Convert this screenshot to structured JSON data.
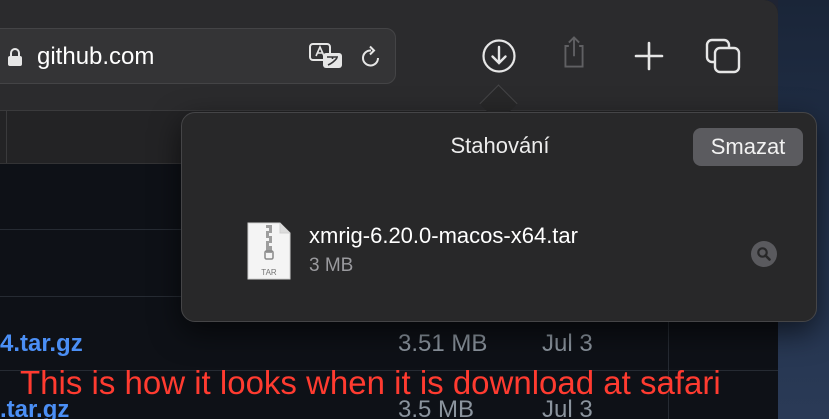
{
  "toolbar": {
    "url": "github.com"
  },
  "file_list": [
    {
      "name": "4.tar.gz",
      "size": "3.51 MB",
      "date": "Jul 3"
    },
    {
      "name": ".tar.gz",
      "size": "3.5 MB",
      "date": "Jul 3"
    }
  ],
  "downloads_popover": {
    "title": "Stahování",
    "clear_label": "Smazat",
    "items": [
      {
        "file_name": "xmrig-6.20.0-macos-x64.tar",
        "size": "3 MB",
        "file_type": "TAR"
      }
    ]
  },
  "annotation": "This is how it looks when it is download at safari",
  "colors": {
    "annotation": "#ff3b30",
    "link": "#4b8ff5",
    "popover_bg": "#282829",
    "clear_button_bg": "#5b5b5f"
  },
  "icons": [
    "lock-icon",
    "translate-icon",
    "reload-icon",
    "download-icon",
    "share-icon",
    "plus-icon",
    "tabs-icon",
    "file-archive-icon",
    "magnifier-icon"
  ]
}
